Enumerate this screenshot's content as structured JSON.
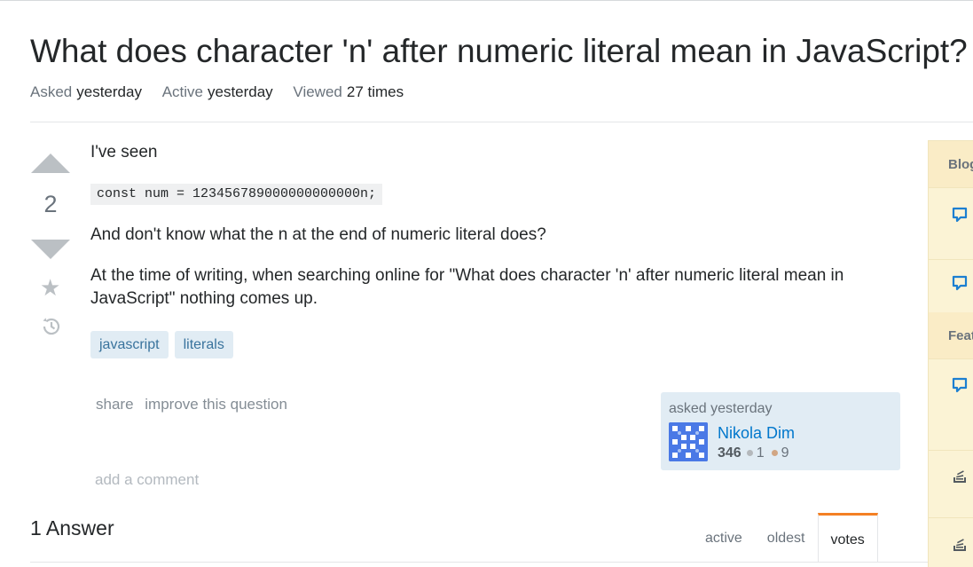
{
  "question": {
    "title": "What does character 'n' after numeric literal mean in JavaScript?",
    "meta": {
      "asked_label": "Asked",
      "asked_value": "yesterday",
      "active_label": "Active",
      "active_value": "yesterday",
      "viewed_label": "Viewed",
      "viewed_value": "27 times"
    },
    "vote_count": "2",
    "body": {
      "p1": "I've seen",
      "code": "const num = 123456789000000000000n;",
      "p2": "And don't know what the n at the end of numeric literal does?",
      "p3": "At the time of writing, when searching online for \"What does character 'n' after numeric literal mean in JavaScript\" nothing comes up."
    },
    "tags": [
      "javascript",
      "literals"
    ],
    "post_menu": {
      "share": "share",
      "improve": "improve this question"
    },
    "owner": {
      "asked_text": "asked yesterday",
      "name": "Nikola Dim",
      "reputation": "346",
      "silver_badges": "1",
      "bronze_badges": "9"
    },
    "add_comment": "add a comment"
  },
  "answers": {
    "header": "1 Answer",
    "sort_tabs": [
      "active",
      "oldest",
      "votes"
    ],
    "selected_tab": "votes"
  },
  "sidebar": {
    "section1": "Blog",
    "section2": "Featured"
  },
  "colors": {
    "accent": "#f48024",
    "link": "#0077cc",
    "tag_bg": "#e1ecf4",
    "tag_fg": "#39739d",
    "sidebar_bg": "#fbf3d5"
  },
  "icons": {
    "vote_up": "arrow-up-icon",
    "vote_down": "arrow-down-icon",
    "favorite": "star-icon",
    "history": "history-icon",
    "sidebar_blog": "speech-bubble-icon",
    "sidebar_meta": "stack-exchange-icon"
  }
}
